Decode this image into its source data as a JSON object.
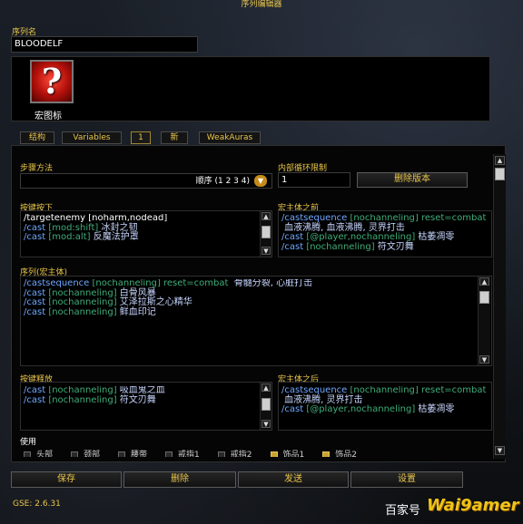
{
  "window": {
    "title": "序列编辑器"
  },
  "sequence_name": {
    "label": "序列名",
    "value": "BLOODELF"
  },
  "macro_icon": {
    "glyph": "?",
    "label": "宏图标"
  },
  "tabs": [
    "结构",
    "Variables",
    "1",
    "新",
    "WeakAuras"
  ],
  "step_method": {
    "label": "步骤方法",
    "value": "顺序 (1 2 3 4)"
  },
  "inner_loop": {
    "label": "内部循环限制",
    "value": "1"
  },
  "delete_version_label": "删除版本",
  "keypress": {
    "label": "按键按下",
    "lines": [
      [
        {
          "t": "/targetenemy [noharm,nodead]",
          "c": "c-w"
        }
      ],
      [
        {
          "t": "/cast ",
          "c": "c-b"
        },
        {
          "t": "[mod:shift]",
          "c": "c-g"
        },
        {
          "t": " 冰封之韧",
          "c": "c-light"
        }
      ],
      [
        {
          "t": "/cast ",
          "c": "c-b"
        },
        {
          "t": "[mod:alt]",
          "c": "c-g"
        },
        {
          "t": " 反魔法护罩",
          "c": "c-light"
        }
      ]
    ]
  },
  "pre_macro": {
    "label": "宏主体之前",
    "lines": [
      [
        {
          "t": "/castsequence ",
          "c": "c-b"
        },
        {
          "t": "[nochanneling] reset=combat",
          "c": "c-g"
        }
      ],
      [
        {
          "t": " 血液沸腾, 血液沸腾, 灵界打击",
          "c": "c-light"
        }
      ],
      [
        {
          "t": "/cast ",
          "c": "c-b"
        },
        {
          "t": "[@player,nochanneling]",
          "c": "c-g"
        },
        {
          "t": " 枯萎凋零",
          "c": "c-light"
        }
      ],
      [
        {
          "t": "/cast ",
          "c": "c-b"
        },
        {
          "t": "[nochanneling]",
          "c": "c-g"
        },
        {
          "t": " 符文刃舞",
          "c": "c-light"
        }
      ]
    ]
  },
  "sequence_body": {
    "label": "序列(宏主体)",
    "lines": [
      [
        {
          "t": "/castsequence ",
          "c": "c-b"
        },
        {
          "t": "[nochanneling] reset=combat",
          "c": "c-g"
        },
        {
          "t": "  骨髓分裂, 心脏打击",
          "c": "c-light"
        }
      ],
      [
        {
          "t": "/cast ",
          "c": "c-b"
        },
        {
          "t": "[nochanneling]",
          "c": "c-g"
        },
        {
          "t": " 白骨风暴",
          "c": "c-light"
        }
      ],
      [
        {
          "t": "/cast ",
          "c": "c-b"
        },
        {
          "t": "[nochanneling]",
          "c": "c-g"
        },
        {
          "t": " 艾泽拉斯之心精华",
          "c": "c-light"
        }
      ],
      [
        {
          "t": "/cast ",
          "c": "c-b"
        },
        {
          "t": "[nochanneling]",
          "c": "c-g"
        },
        {
          "t": " 鲜血印记",
          "c": "c-light"
        }
      ]
    ]
  },
  "keyrelease": {
    "label": "按键释放",
    "lines": [
      [
        {
          "t": "/cast ",
          "c": "c-b"
        },
        {
          "t": "[nochanneling]",
          "c": "c-g"
        },
        {
          "t": " 吸血鬼之血",
          "c": "c-light"
        }
      ],
      [
        {
          "t": "/cast ",
          "c": "c-b"
        },
        {
          "t": "[nochanneling]",
          "c": "c-g"
        },
        {
          "t": " 符文刃舞",
          "c": "c-light"
        }
      ]
    ]
  },
  "post_macro": {
    "label": "宏主体之后",
    "lines": [
      [
        {
          "t": "/castsequence ",
          "c": "c-b"
        },
        {
          "t": "[nochanneling] reset=combat",
          "c": "c-g"
        }
      ],
      [
        {
          "t": " 血液沸腾, 灵界打击",
          "c": "c-light"
        }
      ],
      [
        {
          "t": "/cast ",
          "c": "c-b"
        },
        {
          "t": "[@player,nochanneling]",
          "c": "c-g"
        },
        {
          "t": " 枯萎凋零",
          "c": "c-light"
        }
      ]
    ]
  },
  "use": {
    "label": "使用",
    "items": [
      {
        "label": "头部",
        "checked": false
      },
      {
        "label": "颈部",
        "checked": false
      },
      {
        "label": "腰带",
        "checked": false
      },
      {
        "label": "戒指1",
        "checked": false
      },
      {
        "label": "戒指2",
        "checked": false
      },
      {
        "label": "饰品1",
        "checked": true
      },
      {
        "label": "饰品2",
        "checked": true
      }
    ]
  },
  "buttons": {
    "save": "保存",
    "delete": "删除",
    "send": "发送",
    "settings": "设置"
  },
  "version": "GSE: 2.6.31",
  "watermark": {
    "text": "百家号",
    "brand": "Wai9amer"
  },
  "colors": {
    "gold": "#e8c54a",
    "green": "#3fae7a",
    "blue": "#6fa8ff"
  }
}
